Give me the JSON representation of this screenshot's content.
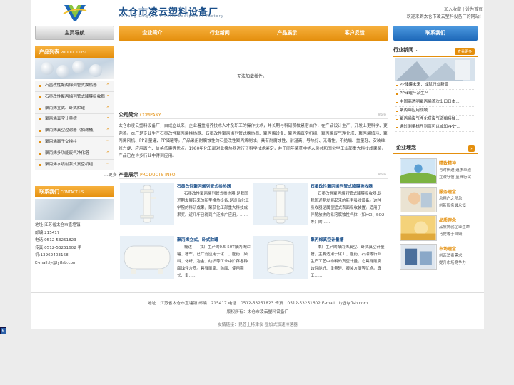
{
  "header": {
    "title": "太仓市凌云塑料设备厂",
    "subtitle": "Taicang Lingyun Plastic Equipment Factory",
    "top_links": "加入收藏 | 设为首页",
    "welcome": "欢迎来到太仓市凌云塑料设备厂的网站!"
  },
  "nav": {
    "home": "主页导航",
    "items": [
      "企业简介",
      "行业新闻",
      "产品展示",
      "客户反馈"
    ],
    "contact": "联系我们"
  },
  "categories": {
    "title": "产品列表",
    "title_en": "PRODUCT LIST",
    "items": [
      "石墨改性聚丙烯列管式换热器",
      "石墨改性聚丙烯列管式降膜吸收器",
      "聚丙烯立式、卧式贮罐",
      "聚丙烯真空计量槽",
      "聚丙烯真空过滤器（抽滤桶）",
      "聚丙烯离子交换柱",
      "聚丙烯多功能废气净化塔",
      "聚丙烯水喷射泵式真空机组"
    ],
    "more": "...更多"
  },
  "contact": {
    "title": "联系我们",
    "title_en": "CONTACT US",
    "lines": [
      "地址:江苏省太仓市直塘镇",
      "邮编:215417",
      "电话:0512-53251823",
      "传真:0512-53251602 手机:13962403168",
      "E-mail:ly@lyflsb.com"
    ]
  },
  "flash": {
    "message": "无法加载插件。"
  },
  "company": {
    "title": "公司简介",
    "title_en": "COMPANY",
    "more": "more",
    "text": "太仓市凌云塑料设备厂，自成立以来，企业着重培养技术人才及职工的操作技术，并长期与科研院校紧密合作，在产品设计生产、开发上更科学、更完善。本厂是专业生产石墨改性聚丙烯换热器、石墨改性聚丙烯列管式换热器、聚丙烯设备、聚丙烯真空机组、聚丙烯废气净化塔、聚丙烯填料、聚丙烯风机、PP计量罐、PP储罐等。产品采用耐腐蚀性的石墨改性聚丙烯制成，具有耐腐蚀性、耐温高、导热好、无毒性、不结垢、重量轻、安装维修方便、应用面广、价格低廉等优点。1980年化工部对此换热器进行了科学技术鉴定，并于同年荣获中华人民共和国化学工业部重大科技成果奖，产品已在许多行业中得到应用。"
  },
  "products": {
    "title": "产品展示",
    "title_en": "PRODUCTS INFO",
    "more": "more",
    "items": [
      {
        "name": "石墨改性聚丙烯列管式换热器",
        "desc": "石墨改性聚丙烯列管式换热器,是我国近期发展起来的新型换热设备,是适合化工学院的科研成果，荣获化工部重大科技成果奖。近几年已得到广泛推广应用。……"
      },
      {
        "name": "石墨改性聚丙烯列管式降膜吸收器",
        "desc": "石墨改性聚丙烯列管式降膜吸收器,是我国近期发展起来的新型吸收设备。这种吸收器是属湿壁式表面吸收装置。适用于伴随放热的易溶腐蚀性气体（如HCl、SO2等）的……"
      },
      {
        "name": "聚丙烯立式、卧式贮罐",
        "desc": "概述　　我厂生产的0.5-50T聚丙烯贮罐、槽车，已广泛应用于化工、医药、染料、化纤、冶金、纺织等工业中贮存各种腐蚀性介质。具有耐腐、防腐、使用期长、重……"
      },
      {
        "name": "聚丙烯真空计量槽",
        "desc": "本厂生产的聚丙烯真空、卧式真空计量槽，主要适用于化工、医药、石油等行业生产工艺中物料的真空计量，它具有耐腐蚀性能好、重量轻、搬装方便等优点。真工……"
      }
    ]
  },
  "news": {
    "title": "行业新闻",
    "more": "查看更多",
    "items": [
      "PP储罐未来：成就行业新篇",
      "PP储罐产品生产",
      "中国高透明聚丙烯首次出口日本...",
      "聚丙烯应用领域",
      "聚丙烯废气净化塔废气道相接触...",
      "通过测量标尺到腐可以或知PP计..."
    ]
  },
  "ideas": {
    "title": "企业理念",
    "arrow": "›",
    "items": [
      {
        "title": "精致精神",
        "lines": [
          "与时俱进 追求卓越",
          "立诚守信 至真行实"
        ]
      },
      {
        "title": "服务理念",
        "lines": [
          "急用户之所急",
          "创新服务最永恒"
        ]
      },
      {
        "title": "品质理念",
        "lines": [
          "品质铸就企业生命",
          "马虎等于自毁"
        ]
      },
      {
        "title": "市场理念",
        "lines": [
          "创造消费需求",
          "提升市场竞争力"
        ]
      }
    ]
  },
  "footer": {
    "line1": "地址：江苏省太仓市直塘镇 邮编：215417 电话：0512-53251823 传真：0512-53251602 E-mail：ly@lyflsb.com",
    "line2": "版权所有：太仓市凌云塑料设备厂",
    "links": "友情链接：昆苍土特津仪 昼加式双速排落器"
  },
  "colors": {
    "orange": "#e48f0d",
    "blue": "#1a4f8a",
    "contact_blue": "#1d67b8"
  },
  "icons": {
    "logo": "v-logo-icon",
    "corner": "ie-icon"
  }
}
